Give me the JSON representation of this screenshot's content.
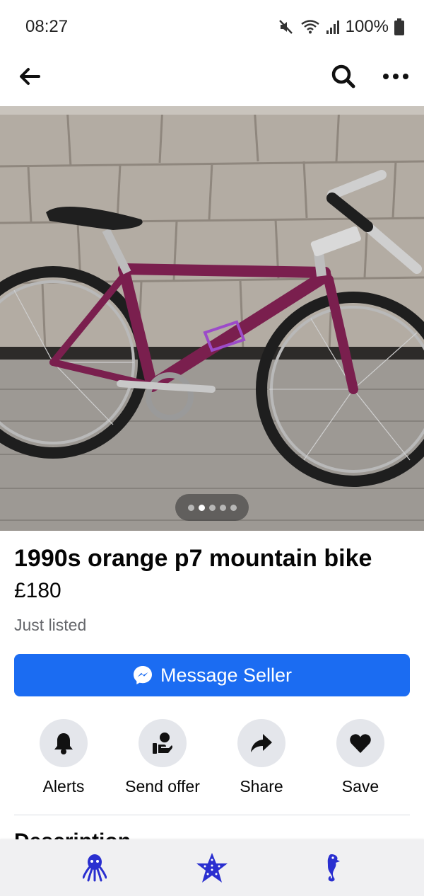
{
  "status_bar": {
    "time": "08:27",
    "battery": "100%",
    "icons": [
      "mute-icon",
      "wifi-icon",
      "signal-icon",
      "battery-icon"
    ]
  },
  "header": {
    "icons": [
      "back-arrow-icon",
      "search-icon",
      "more-options-icon"
    ]
  },
  "gallery": {
    "image_count": 5,
    "active_index": 1
  },
  "listing": {
    "title": "1990s orange p7 mountain bike",
    "price": "£180",
    "posted": "Just listed"
  },
  "message_button": {
    "label": "Message Seller",
    "icon": "messenger-icon"
  },
  "actions": [
    {
      "label": "Alerts",
      "icon": "bell-icon"
    },
    {
      "label": "Send offer",
      "icon": "offer-hand-icon"
    },
    {
      "label": "Share",
      "icon": "share-arrow-icon"
    },
    {
      "label": "Save",
      "icon": "heart-icon"
    }
  ],
  "description_heading": "Description",
  "bottom_nav": {
    "icons": [
      "octopus-icon",
      "starfish-icon",
      "seahorse-icon"
    ],
    "color": "#2a2fd0"
  },
  "colors": {
    "accent": "#1b6cf2",
    "secondary_text": "#65676b",
    "action_bg": "#e4e6eb"
  }
}
